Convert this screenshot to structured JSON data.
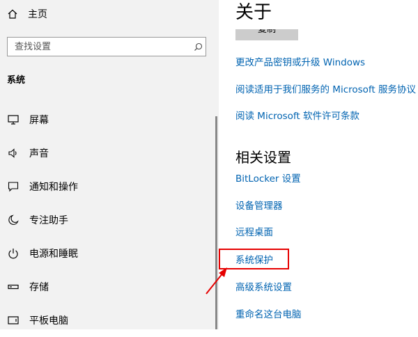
{
  "sidebar": {
    "home_label": "主页",
    "search_placeholder": "查找设置",
    "section_label": "系统",
    "items": [
      {
        "label": "屏幕",
        "icon": "monitor-icon"
      },
      {
        "label": "声音",
        "icon": "speaker-icon"
      },
      {
        "label": "通知和操作",
        "icon": "notification-icon"
      },
      {
        "label": "专注助手",
        "icon": "moon-icon"
      },
      {
        "label": "电源和睡眠",
        "icon": "power-icon"
      },
      {
        "label": "存储",
        "icon": "storage-icon"
      },
      {
        "label": "平板电脑",
        "icon": "tablet-icon"
      }
    ]
  },
  "main": {
    "title": "关于",
    "copy_label": "复制",
    "links": [
      "更改产品密钥或升级 Windows",
      "阅读适用于我们服务的 Microsoft 服务协议",
      "阅读 Microsoft 软件许可条款"
    ],
    "related_heading": "相关设置",
    "related_links": [
      "BitLocker 设置",
      "设备管理器",
      "远程桌面",
      "系统保护",
      "高级系统设置",
      "重命名这台电脑"
    ]
  },
  "colors": {
    "link": "#0063b1",
    "highlight": "#e60000",
    "sidebar_bg": "#f2f2f2"
  }
}
